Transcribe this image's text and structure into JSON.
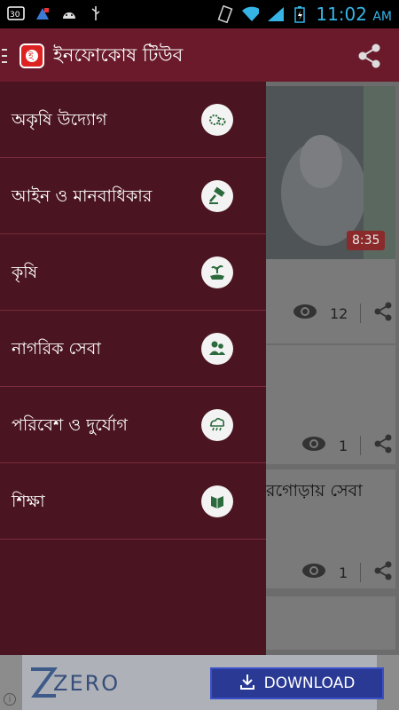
{
  "status_bar": {
    "time": "11:02",
    "ampm": "AM",
    "left_icons": [
      "30-icon",
      "app-notification-icon",
      "android-icon",
      "usb-icon"
    ],
    "right_icons": [
      "vibrate-icon",
      "wifi-icon",
      "signal-icon",
      "battery-icon"
    ]
  },
  "appbar": {
    "title": "ইনফোকোষ টিউব",
    "color": "#6a1a2a"
  },
  "drawer": {
    "items": [
      {
        "label": "অকৃষি উদ্যোগ",
        "icon": "gears-icon"
      },
      {
        "label": "আইন ও মানবাধিকার",
        "icon": "gavel-icon"
      },
      {
        "label": "কৃষি",
        "icon": "plant-hand-icon"
      },
      {
        "label": "নাগরিক সেবা",
        "icon": "people-icon"
      },
      {
        "label": "পরিবেশ ও দুর্যোগ",
        "icon": "storm-cloud-icon"
      },
      {
        "label": "শিক্ষা",
        "icon": "book-icon"
      }
    ]
  },
  "videos": [
    {
      "duration": "8:35",
      "views": "12"
    },
    {
      "views": "1"
    },
    {
      "title_partial": "রগোড়ায় সেবা",
      "views": "1"
    }
  ],
  "ad": {
    "brand": "ZERO",
    "button_label": "DOWNLOAD",
    "info": "i"
  }
}
